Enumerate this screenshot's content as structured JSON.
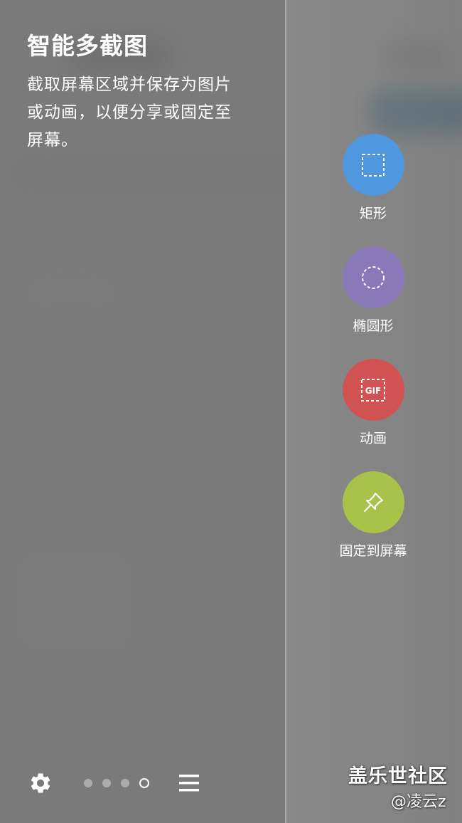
{
  "intro": {
    "title": "智能多截图",
    "description": "截取屏幕区域并保存为图片或动画，以便分享或固定至屏幕。"
  },
  "actions": [
    {
      "label": "矩形",
      "icon": "dashed-square-icon",
      "color": "#4f98e0"
    },
    {
      "label": "椭圆形",
      "icon": "dashed-circle-icon",
      "color": "#8a79b8"
    },
    {
      "label": "动画",
      "icon": "gif-icon",
      "icon_text": "GIF",
      "color": "#d05252"
    },
    {
      "label": "固定到屏幕",
      "icon": "pin-icon",
      "color": "#a9c24a"
    }
  ],
  "bottom_bar": {
    "settings_icon": "gear-icon",
    "menu_icon": "hamburger-icon",
    "page_count": 4,
    "active_page": 4
  },
  "watermark": {
    "line1": "盖乐世社区",
    "line2": "@凌云z"
  }
}
